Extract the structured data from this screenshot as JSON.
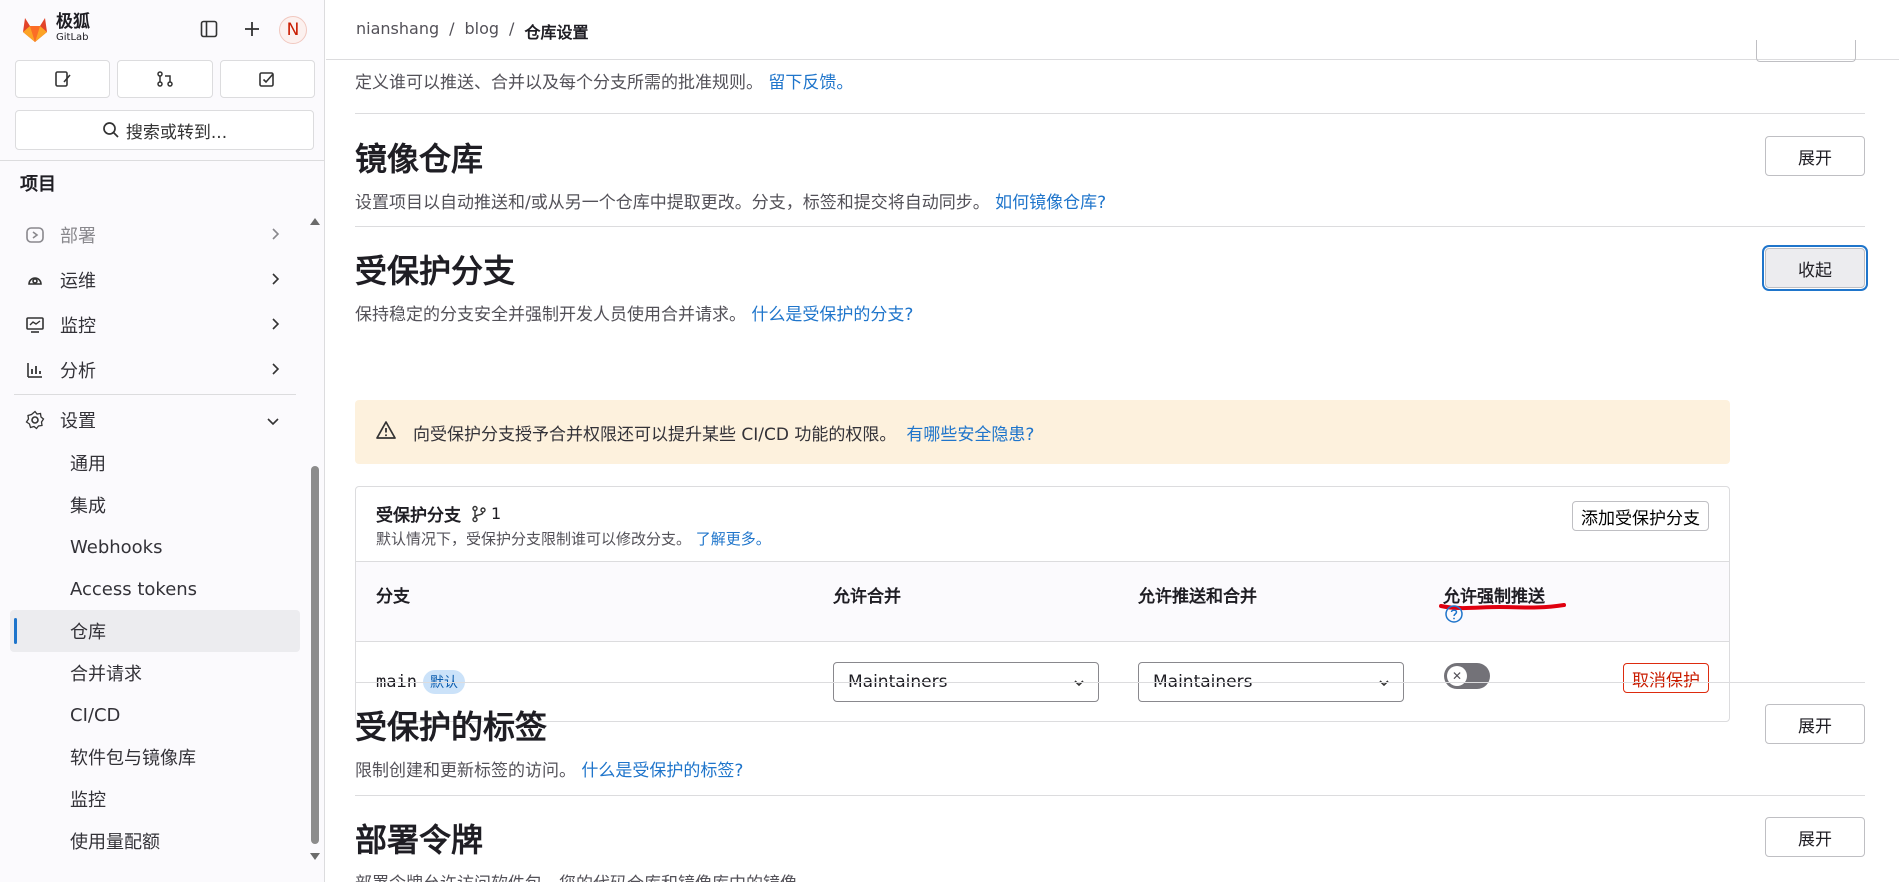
{
  "brand": {
    "name": "极狐",
    "sub": "GitLab"
  },
  "user": {
    "avatar_letter": "N"
  },
  "sidebar": {
    "search_label": "搜索或转到...",
    "section": "项目",
    "items": [
      {
        "label": "部署",
        "icon": "deploy-icon"
      },
      {
        "label": "运维",
        "icon": "operate-icon"
      },
      {
        "label": "监控",
        "icon": "monitor-icon"
      },
      {
        "label": "分析",
        "icon": "analytics-icon"
      },
      {
        "label": "设置",
        "icon": "settings-icon"
      }
    ],
    "subitems": [
      "通用",
      "集成",
      "Webhooks",
      "Access tokens",
      "仓库",
      "合并请求",
      "CI/CD",
      "软件包与镜像库",
      "监控",
      "使用量配额"
    ],
    "active": "仓库"
  },
  "breadcrumb": {
    "group": "nianshang",
    "project": "blog",
    "current": "仓库设置"
  },
  "sections": {
    "branch_rules": {
      "desc": "定义谁可以推送、合并以及每个分支所需的批准规则。",
      "link": "留下反馈。"
    },
    "mirror": {
      "title": "镜像仓库",
      "desc": "设置项目以自动推送和/或从另一个仓库中提取更改。分支，标签和提交将自动同步。",
      "link": "如何镜像仓库?",
      "button": "展开"
    },
    "protected_branches": {
      "title": "受保护分支",
      "desc": "保持稳定的分支安全并强制开发人员使用合并请求。",
      "link": "什么是受保护的分支?",
      "button": "收起"
    },
    "protected_tags": {
      "title": "受保护的标签",
      "desc": "限制创建和更新标签的访问。",
      "link": "什么是受保护的标签?",
      "button": "展开"
    },
    "deploy_tokens": {
      "title": "部署令牌",
      "desc": "部署令牌允许访问软件包，您的代码仓库和镜像库中的镜像。",
      "button": "展开"
    }
  },
  "alert": {
    "text": "向受保护分支授予合并权限还可以提升某些 CI/CD 功能的权限。",
    "link": "有哪些安全隐患?"
  },
  "card": {
    "title": "受保护分支",
    "count": "1",
    "subtitle": "默认情况下，受保护分支限制谁可以修改分支。",
    "subtitle_link": "了解更多。",
    "add_button": "添加受保护分支",
    "columns": [
      "分支",
      "允许合并",
      "允许推送和合并",
      "允许强制推送"
    ],
    "rows": [
      {
        "branch": "main",
        "badge": "默认",
        "merge": "Maintainers",
        "push_merge": "Maintainers",
        "force_push": false,
        "action": "取消保护"
      }
    ]
  },
  "colors": {
    "link": "#1f75cb",
    "annotation": "#e0000f",
    "alert_bg": "#fdf1dd"
  }
}
